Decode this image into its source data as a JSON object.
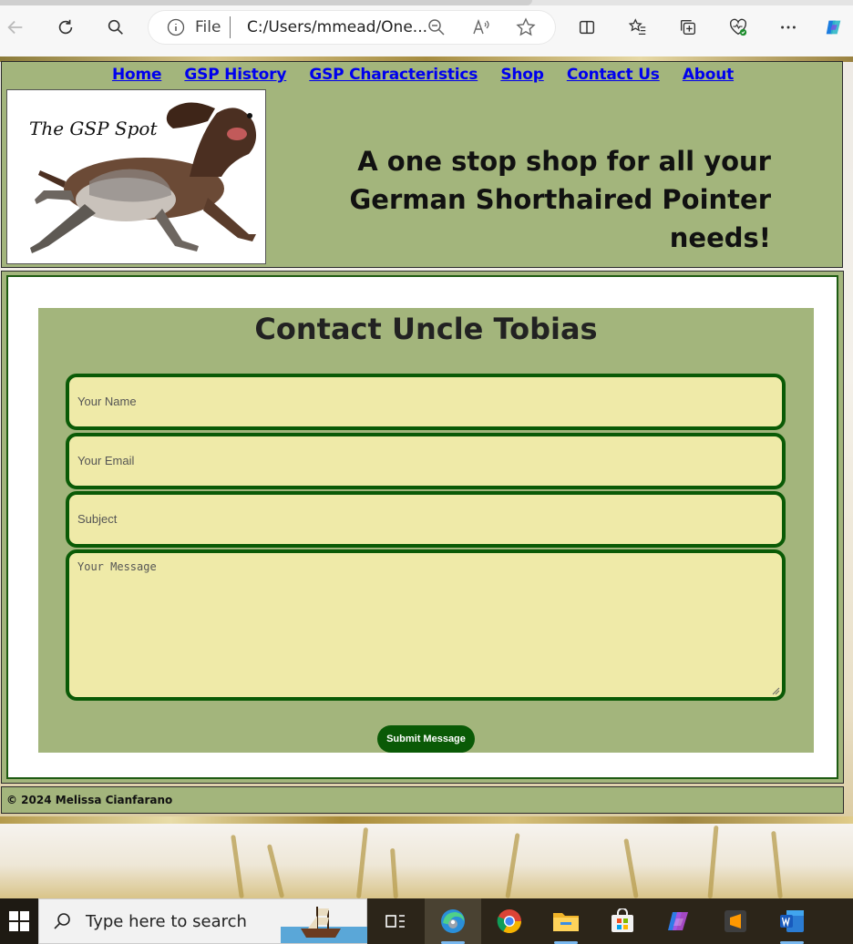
{
  "browser": {
    "file_label": "File",
    "url": "C:/Users/mmead/One..."
  },
  "site": {
    "nav": [
      "Home",
      "GSP History",
      "GSP Characteristics",
      "Shop",
      "Contact Us",
      "About"
    ],
    "logo_text": "The GSP Spot",
    "tagline_line1": "A one stop shop for all your",
    "tagline_line2": "German Shorthaired Pointer needs!"
  },
  "contact_form": {
    "title": "Contact Uncle Tobias",
    "name_placeholder": "Your Name",
    "email_placeholder": "Your Email",
    "subject_placeholder": "Subject",
    "message_placeholder": "Your Message",
    "submit_label": "Submit Message"
  },
  "footer": {
    "copyright": "© 2024 Melissa Cianfarano"
  },
  "taskbar": {
    "search_placeholder": "Type here to search"
  },
  "colors": {
    "panel_green": "#a3b57c",
    "field_yellow": "#efeaa8",
    "dark_green": "#0a5a06",
    "link_blue": "#0000ee"
  }
}
